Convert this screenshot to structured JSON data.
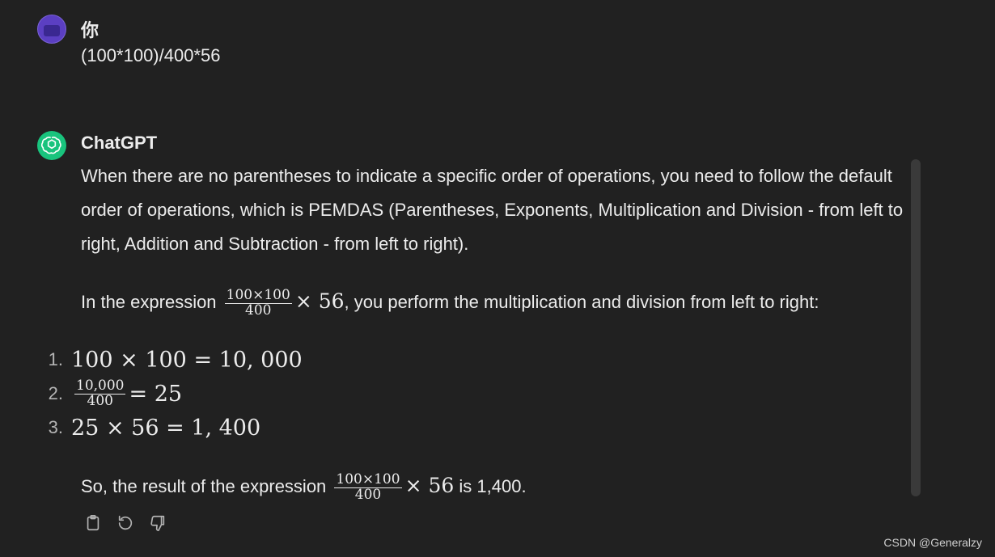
{
  "user": {
    "name": "你",
    "message": "(100*100)/400*56"
  },
  "assistant": {
    "name": "ChatGPT",
    "paragraph1": "When there are no parentheses to indicate a specific order of operations, you need to follow the default order of operations, which is PEMDAS (Parentheses, Exponents, Multiplication and Division - from left to right, Addition and Subtraction - from left to right).",
    "paragraph2": {
      "before": "In the expression",
      "frac_num": "100×100",
      "frac_den": "400",
      "times": "× 56",
      "after": ", you perform the multiplication and division from left to right:"
    },
    "steps": [
      {
        "label": "1.",
        "expr": "100 × 100 = 10, 000"
      },
      {
        "label": "2.",
        "frac_num": "10,000",
        "frac_den": "400",
        "rest": "= 25"
      },
      {
        "label": "3.",
        "expr": "25 × 56 = 1, 400"
      }
    ],
    "conclusion": {
      "before": "So, the result of the expression",
      "frac_num": "100×100",
      "frac_den": "400",
      "times": "× 56",
      "after": " is 1,400."
    }
  },
  "actions": {
    "copy_icon": "clipboard-icon",
    "regenerate_icon": "regenerate-icon",
    "dislike_icon": "thumbs-down-icon"
  },
  "watermark": "CSDN @Generalzy"
}
